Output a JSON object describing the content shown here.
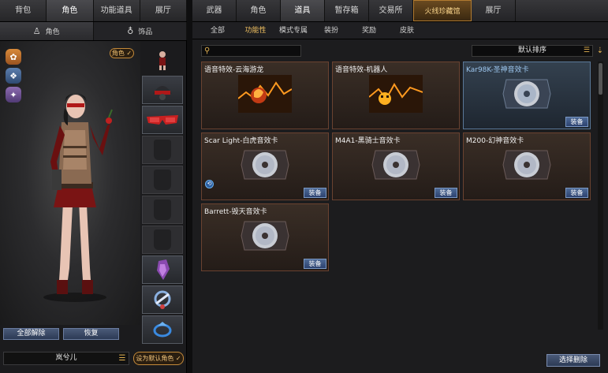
{
  "left": {
    "tabs": [
      "背包",
      "角色",
      "功能道具",
      "展厅"
    ],
    "active_tab": 1,
    "subtabs": [
      {
        "label": "角色",
        "icon": "character-icon"
      },
      {
        "label": "饰品",
        "icon": "ornament-icon"
      }
    ],
    "role_badge": "角色 ✓",
    "buttons": {
      "remove_all": "全部解除",
      "restore": "恢复"
    },
    "character_name": "岚兮儿",
    "set_default": "设为默认角色 ✓"
  },
  "right": {
    "tabs": [
      "武器",
      "角色",
      "道具",
      "暂存箱",
      "交易所",
      "火线珍藏馆",
      "展厅"
    ],
    "active_tab": 2,
    "subtabs": [
      "全部",
      "功能性",
      "模式专属",
      "装扮",
      "奖励",
      "皮肤"
    ],
    "active_subtab": 1,
    "search": {
      "placeholder": ""
    },
    "sort": {
      "label": "默认排序"
    },
    "items": [
      {
        "title": "语音特效-云海游龙",
        "style": "warm",
        "art": "dragon-voice-effect",
        "equip": ""
      },
      {
        "title": "语音特效-机器人",
        "style": "warm",
        "art": "robot-voice-effect",
        "equip": ""
      },
      {
        "title": "Kar98K-圣神音效卡",
        "style": "blue",
        "art": "cd-sound-card",
        "equip": "装备"
      },
      {
        "title": "Scar Light-白虎音效卡",
        "style": "warm",
        "art": "cd-sound-card",
        "equip": "装备"
      },
      {
        "title": "M4A1-黑骑士音效卡",
        "style": "warm",
        "art": "cd-sound-card",
        "equip": "装备"
      },
      {
        "title": "M200-幻神音效卡",
        "style": "warm",
        "art": "cd-sound-card",
        "equip": "装备"
      },
      {
        "title": "Barrett-毁天音效卡",
        "style": "warm",
        "art": "cd-sound-card",
        "equip": "装备"
      }
    ],
    "select_remove": "选择删除"
  }
}
